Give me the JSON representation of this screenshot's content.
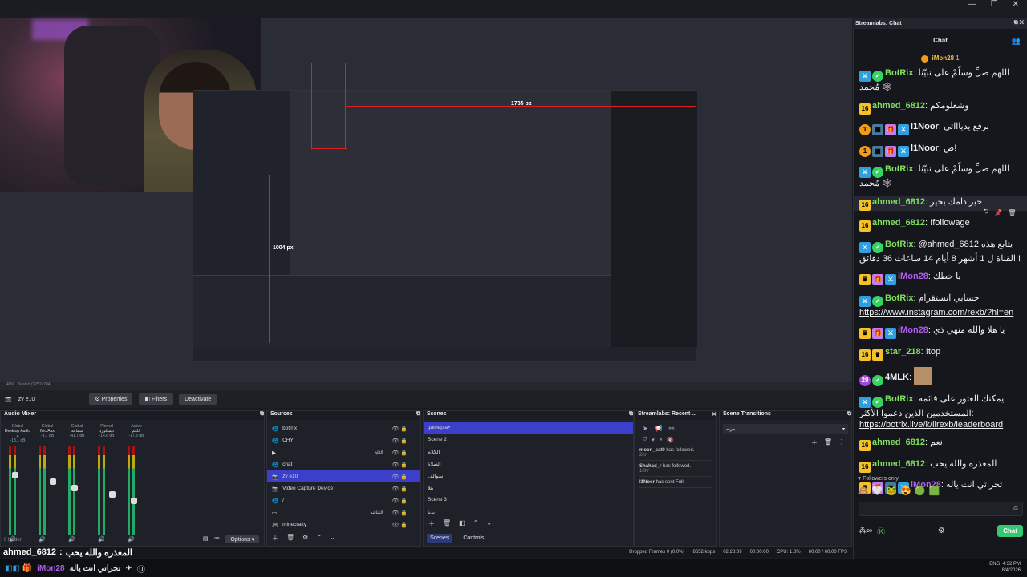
{
  "window": {
    "minimize": "—",
    "maximize": "❐",
    "close": "✕"
  },
  "preview": {
    "zoom": "48%",
    "scale_text": "Scaled (1252x704)",
    "dim_1785": "1785 px",
    "dim_1004": "1004 px"
  },
  "source_toolbar": {
    "current_source": "zv e10",
    "properties": "Properties",
    "filters": "Filters",
    "deactivate": "Deactivate"
  },
  "mixer": {
    "title": "Audio Mixer",
    "channels": [
      {
        "group": "Global",
        "name": "Desktop Audio 2",
        "db": "-18.1 dB"
      },
      {
        "group": "Global",
        "name": "Mic/Aux",
        "db": "-3.7 dB"
      },
      {
        "group": "Global",
        "name": "سماعة",
        "db": "-41.7 dB"
      },
      {
        "group": "Pinned",
        "name": "دیسکورد",
        "db": "-14.6 dB"
      },
      {
        "group": "Active",
        "name": "اللكم",
        "db": "-17.3 dB"
      }
    ],
    "hidden": "0 hidden",
    "options": "Options"
  },
  "sources": {
    "title": "Sources",
    "items": [
      {
        "label": "botrrix",
        "icon": "🌐"
      },
      {
        "label": "CHY",
        "icon": "🌐"
      },
      {
        "label": "",
        "icon": "▶",
        "right": "الكلح"
      },
      {
        "label": "chat",
        "icon": "🌐"
      },
      {
        "label": "zv e10",
        "icon": "📷",
        "selected": true
      },
      {
        "label": "Video Capture Device",
        "icon": "📷"
      },
      {
        "label": "/",
        "icon": "🌐"
      },
      {
        "label": "",
        "icon": "▭",
        "right": "الشاشه"
      },
      {
        "label": "minecrafty",
        "icon": "🎮"
      }
    ]
  },
  "scenes": {
    "title": "Scenes",
    "items": [
      "gameplay",
      "Scene 2",
      "الكلام",
      "الصلاة",
      "سوالف",
      "هلا",
      "Scene 3",
      "بديا"
    ],
    "tab_scenes": "Scenes",
    "tab_controls": "Controls"
  },
  "alertbox": {
    "title": "Streamlabs: Recent ...",
    "events": [
      {
        "user": "moon_cat0",
        "text": "has followed.",
        "time": "2hr"
      },
      {
        "user": "Shahad_r",
        "text": "has followed.",
        "time": "18hr"
      },
      {
        "user": "l1Noor",
        "text": "has sent Full",
        "time": ""
      }
    ]
  },
  "transitions": {
    "title": "Scene Transitions",
    "selected": "مزيه"
  },
  "status": {
    "dropped": "Dropped Frames 0 (0.0%)",
    "kbps": "8652 kbps",
    "live_time": "02:28:09",
    "rec_time": "00:00:00",
    "cpu": "CPU: 1.8%",
    "fps": "60.00 / 60.00 FPS"
  },
  "overlay_alert": {
    "line1_user": "ahmed_6812",
    "line1_text": "المعذره والله يحب",
    "line2_user": "iMon28",
    "line2_text": "تحراتي انت ياله"
  },
  "taskbar": {
    "lang": "ENG",
    "time": "4:32 PM",
    "date": "8/4/2026"
  },
  "chat": {
    "window_title": "Streamlabs: Chat",
    "header": "Chat",
    "top_user": "iMon28",
    "top_count": "1",
    "messages": [
      {
        "badges": [
          "mod",
          "ver"
        ],
        "user": "BotRix",
        "color": "#7fe05e",
        "text": "اللهم صلِّ وسلّمْ على نبيّنا مُحمد",
        "extra": "🕸"
      },
      {
        "badges": [
          "sub"
        ],
        "user": "ahmed_6812",
        "color": "#7fe05e",
        "text": "وشعلومكم"
      },
      {
        "badges": [
          "coin",
          "art",
          "gift",
          "mod"
        ],
        "user": "l1Noor",
        "color": "#f0f0f0",
        "text": "برفع يدياااتي"
      },
      {
        "badges": [
          "coin",
          "art",
          "gift",
          "mod"
        ],
        "user": "l1Noor",
        "color": "#f0f0f0",
        "text": "ص!"
      },
      {
        "badges": [
          "mod",
          "ver"
        ],
        "user": "BotRix",
        "color": "#7fe05e",
        "text": "اللهم صلِّ وسلّمْ على نبيّنا مُحمد",
        "extra": "🕸"
      },
      {
        "badges": [
          "sub"
        ],
        "user": "ahmed_6812",
        "color": "#7fe05e",
        "text": "خير دامك بخير",
        "highlight": true
      },
      {
        "badges": [
          "sub"
        ],
        "user": "ahmed_6812",
        "color": "#7fe05e",
        "text": "!followage"
      },
      {
        "badges": [
          "mod",
          "ver"
        ],
        "user": "BotRix",
        "color": "#7fe05e",
        "text": "@ahmed_6812 يتابع هذه القناة ل 1 أشهر 8 أيام 14 ساعات 36 دقائق !"
      },
      {
        "badges": [
          "crown",
          "gift",
          "mod"
        ],
        "user": "iMon28",
        "color": "#b25ef0",
        "text": "يا حظك"
      },
      {
        "badges": [
          "mod",
          "ver"
        ],
        "user": "BotRix",
        "color": "#7fe05e",
        "text": "حسابي انستقرام",
        "link": "https://www.instagram.com/rexb/?hl=en"
      },
      {
        "badges": [
          "crown",
          "gift",
          "mod"
        ],
        "user": "iMon28",
        "color": "#b25ef0",
        "text": "يا هلا والله منهي ذي"
      },
      {
        "badges": [
          "sub",
          "crown"
        ],
        "user": "star_218",
        "color": "#7fe05e",
        "text": "!top"
      },
      {
        "badges": [
          "purp",
          "ver"
        ],
        "user": "4MLK",
        "color": "#f0f0f0",
        "text": "",
        "emote": true
      },
      {
        "badges": [
          "mod",
          "ver"
        ],
        "user": "BotRix",
        "color": "#7fe05e",
        "text": "يمكنك العثور على قائمة المستخدمين الذين دعموا الأكثر:",
        "link": "https://botrix.live/k/llrexb/leaderboard"
      },
      {
        "badges": [
          "sub"
        ],
        "user": "ahmed_6812",
        "color": "#7fe05e",
        "text": "نعم"
      },
      {
        "badges": [
          "sub"
        ],
        "user": "ahmed_6812",
        "color": "#7fe05e",
        "text": "المعذره والله يحب"
      },
      {
        "badges": [
          "crown",
          "gift",
          "art",
          "mod"
        ],
        "user": "iMon28",
        "color": "#b25ef0",
        "text": "تحراتي انت ياله"
      }
    ],
    "followers_only": "Followers only",
    "input_placeholder": "",
    "send": "Chat"
  }
}
